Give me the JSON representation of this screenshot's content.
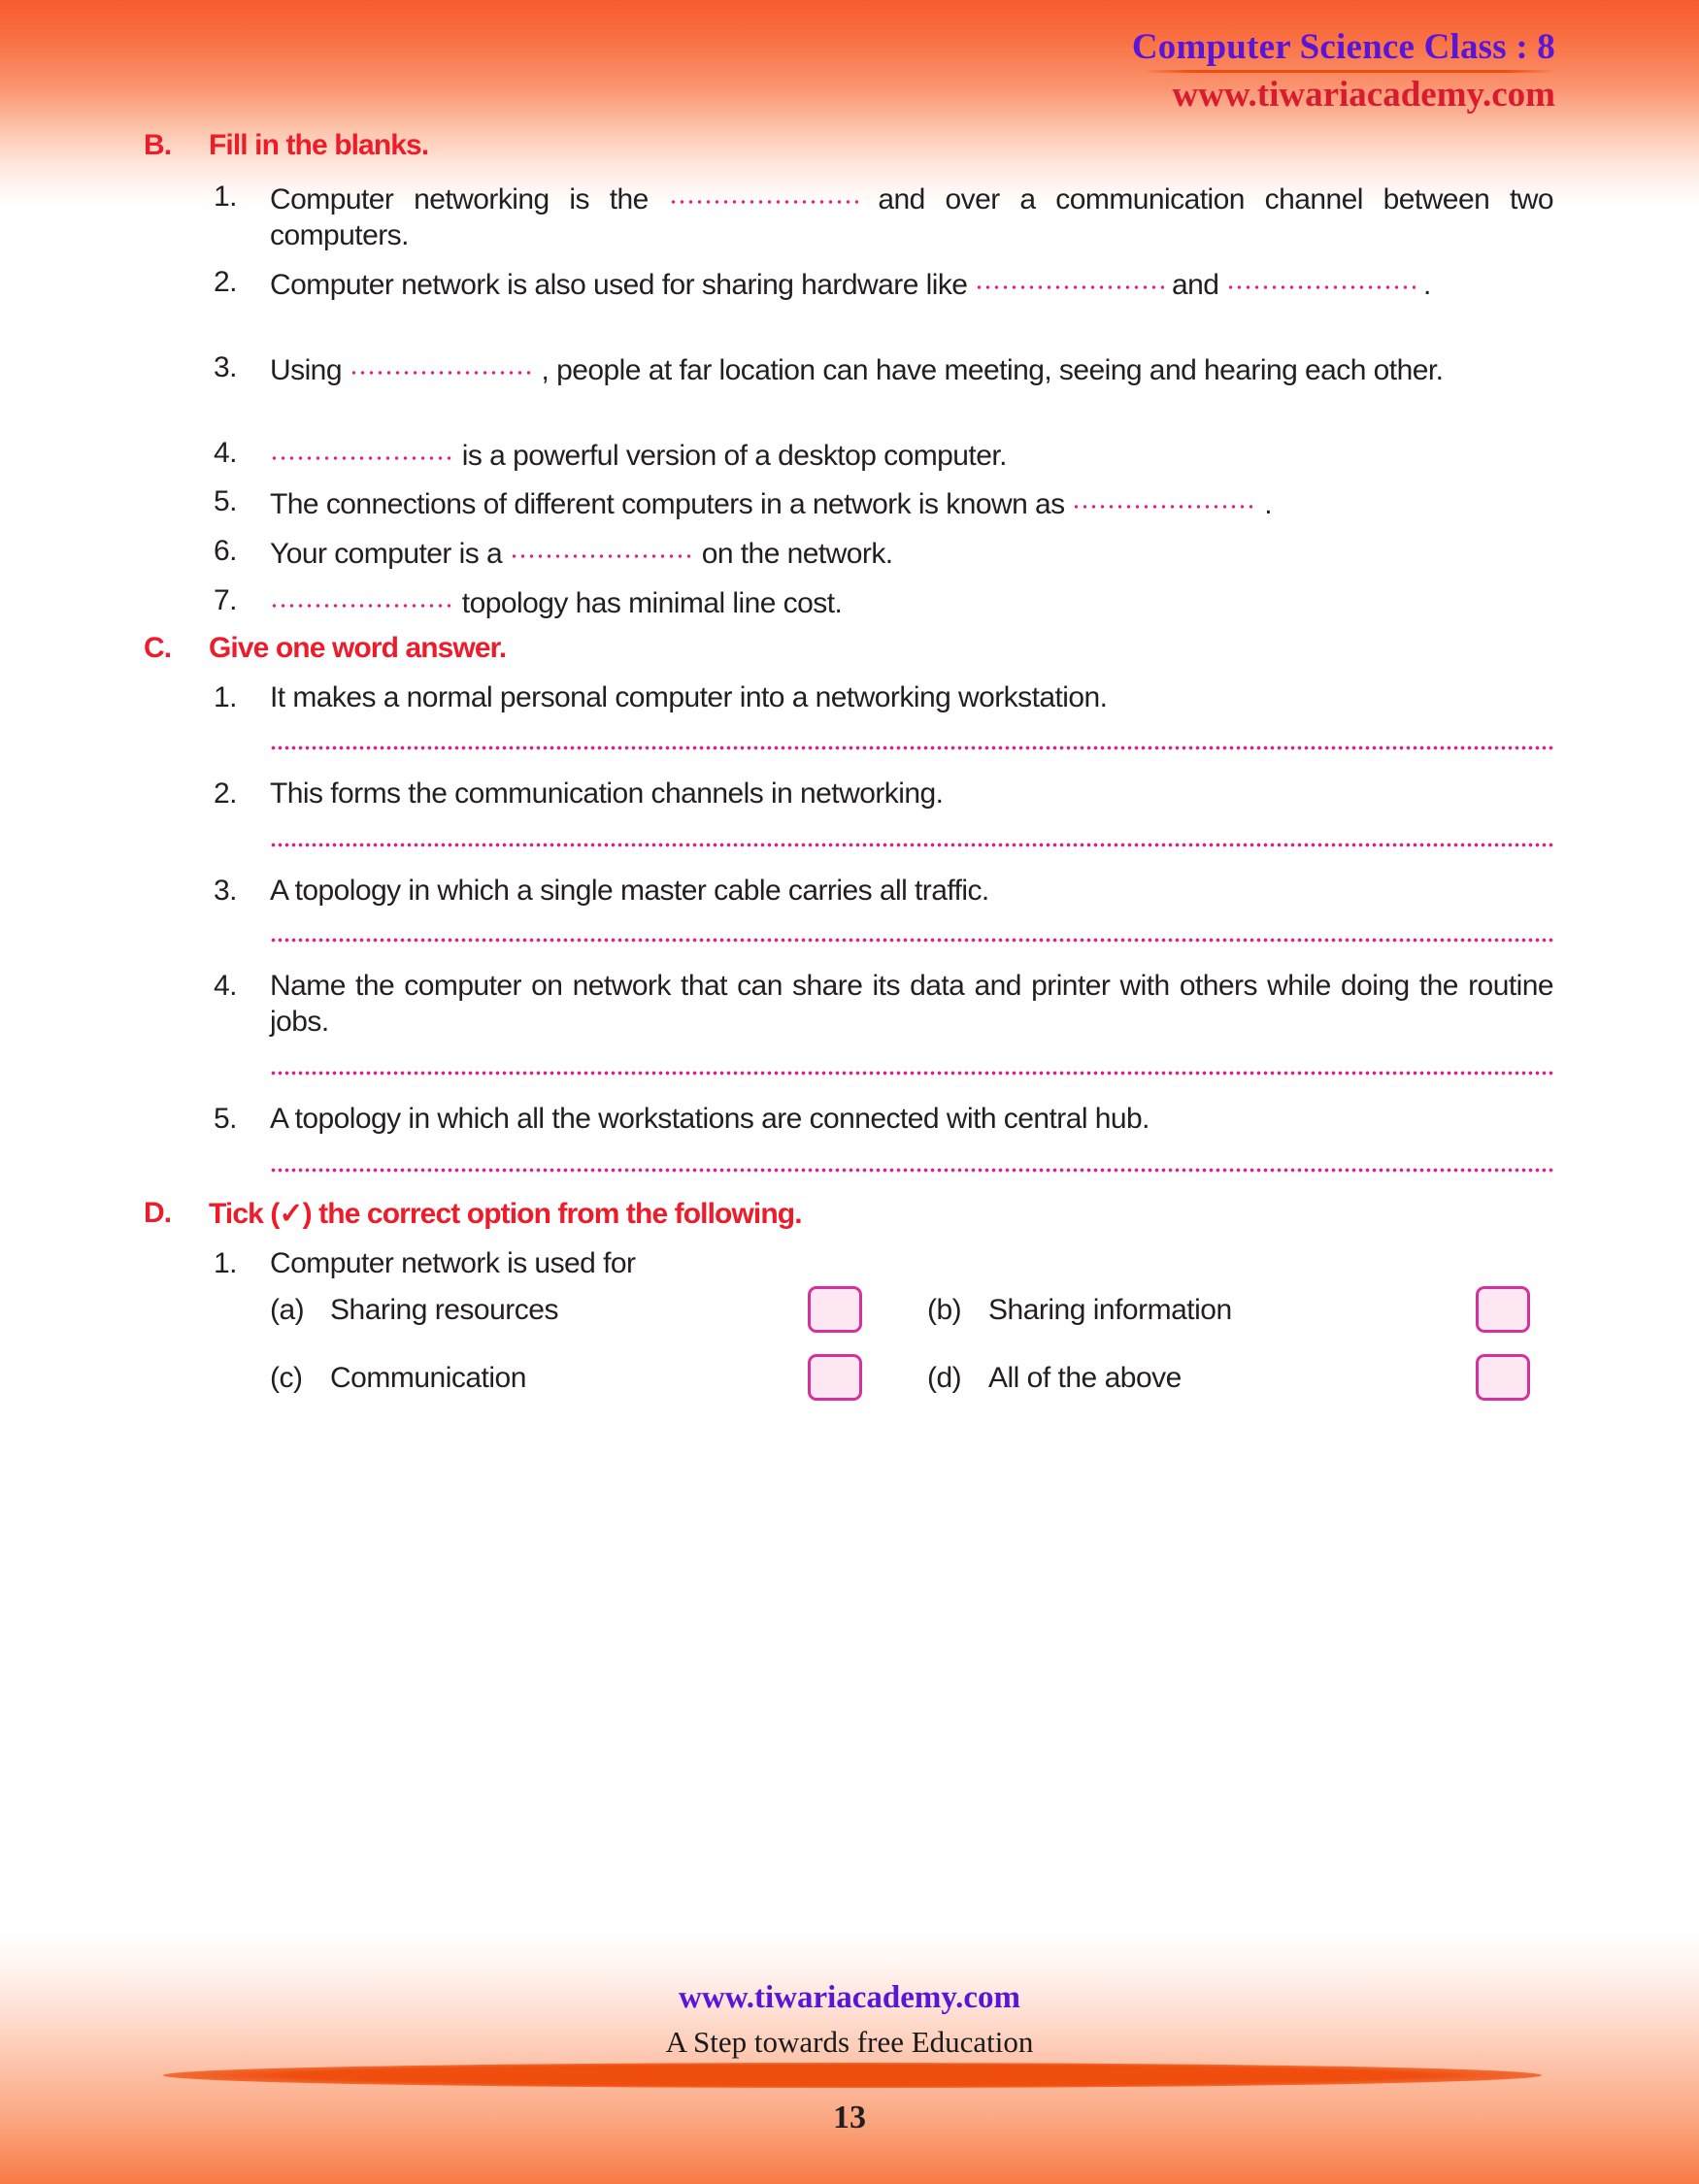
{
  "header": {
    "title": "Computer Science Class : 8",
    "site": "www.tiwariacademy.com"
  },
  "sections": [
    {
      "letter": "B.",
      "title": "Fill in the blanks.",
      "items": [
        {
          "num": "1.",
          "parts": [
            "Computer networking is the ",
            "BLANK",
            " and over a communication channel between two computers."
          ]
        },
        {
          "num": "2.",
          "parts": [
            "Computer network is also used for sharing hardware like ",
            "BLANK",
            " and ",
            "BLANK",
            " ."
          ]
        },
        {
          "num": "3.",
          "parts": [
            "Using ",
            "BLANK",
            " , people at far location can have meeting, seeing and hearing each other."
          ]
        },
        {
          "num": "4.",
          "parts": [
            "",
            "BLANK",
            " is a powerful version of a desktop computer."
          ]
        },
        {
          "num": "5.",
          "parts": [
            "The connections of different computers in a network is known as ",
            "BLANK",
            " ."
          ]
        },
        {
          "num": "6.",
          "parts": [
            "Your computer is a ",
            "BLANK",
            "  on the network."
          ]
        },
        {
          "num": "7.",
          "parts": [
            "",
            "BLANK",
            "  topology has minimal line cost."
          ]
        }
      ]
    },
    {
      "letter": "C.",
      "title": "Give one word answer.",
      "items": [
        {
          "num": "1.",
          "text": "It makes a normal personal computer into a networking workstation."
        },
        {
          "num": "2.",
          "text": "This forms the communication channels in networking."
        },
        {
          "num": "3.",
          "text": "A topology in which a single master cable carries all traffic."
        },
        {
          "num": "4.",
          "text": "Name the computer on network that can share its data and printer with others while doing the routine jobs."
        },
        {
          "num": "5.",
          "text": "A topology in which all the workstations are connected with central hub."
        }
      ]
    },
    {
      "letter": "D.",
      "title": "Tick (✓) the correct option from the following.",
      "question_num": "1.",
      "question_text": "Computer network is used for",
      "options": [
        {
          "letter": "(a)",
          "label": "Sharing resources"
        },
        {
          "letter": "(b)",
          "label": "Sharing information"
        },
        {
          "letter": "(c)",
          "label": "Communication"
        },
        {
          "letter": "(d)",
          "label": "All of the above"
        }
      ]
    }
  ],
  "fill_items": {
    "i1_a": "Computer networking is the",
    "i1_b": "and over a communication channel between two computers.",
    "i2_a": "Computer network is also used for sharing hardware like",
    "i2_b": "and",
    "i2_c": ".",
    "i3_a": "Using",
    "i3_b": ", people at far location can have meeting, seeing and hearing each other.",
    "i4_b": "is a powerful version of a desktop computer.",
    "i5_a": "The connections of different computers in a network is known as",
    "i5_b": ".",
    "i6_a": "Your computer is a",
    "i6_b": "on the network.",
    "i7_b": "topology has minimal line cost."
  },
  "footer": {
    "site": "www.tiwariacademy.com",
    "tagline": "A Step towards free Education",
    "page": "13"
  },
  "colors": {
    "heading_red": "#ed1c2b",
    "title_purple": "#5a15d6",
    "site_red": "#d81b2e",
    "blank_pink": "#e0218a",
    "tick_border": "#d6309b",
    "tick_fill": "#fce7f3",
    "band_orange": "#f04e0e"
  }
}
